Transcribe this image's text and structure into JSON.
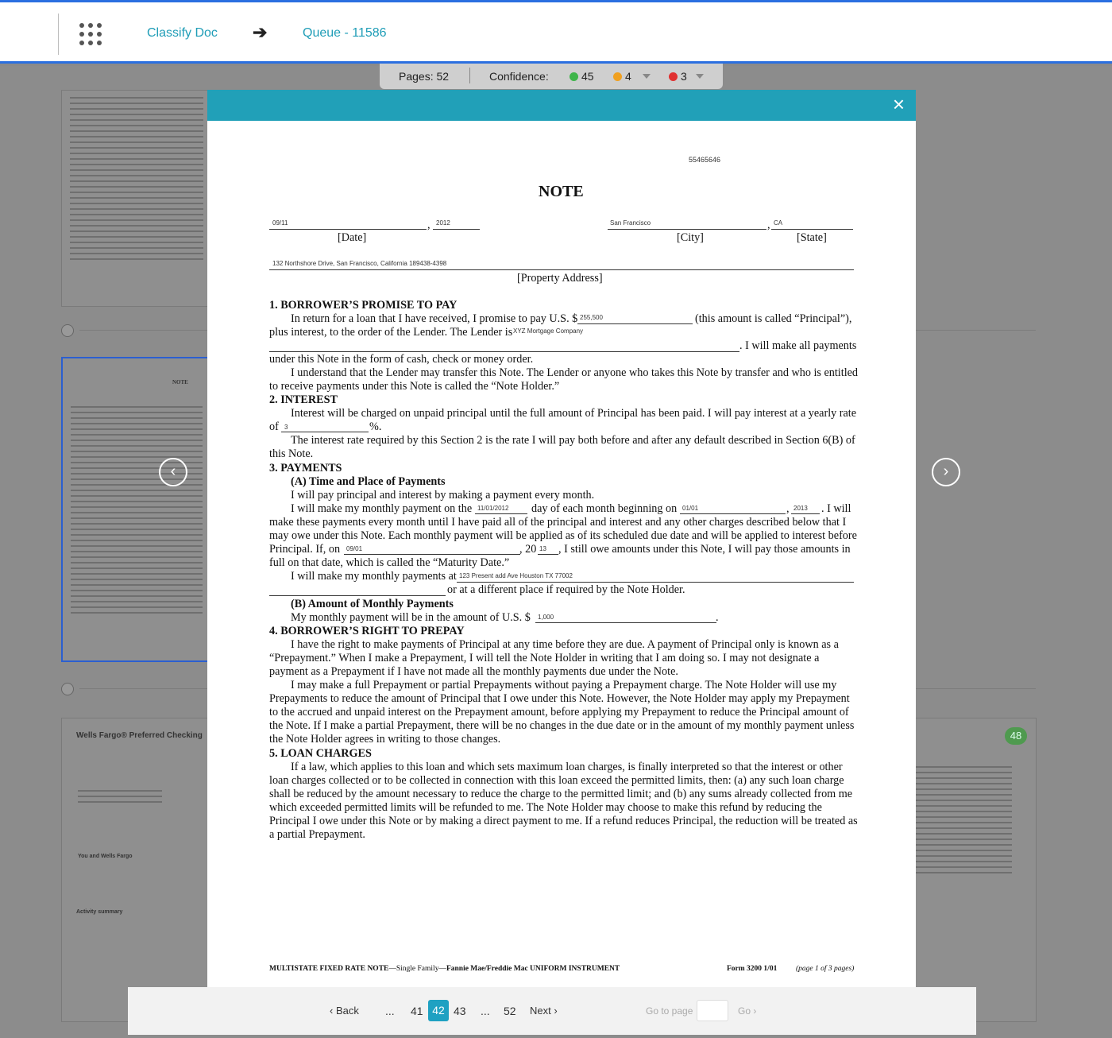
{
  "header": {
    "breadcrumb": [
      "Classify Doc",
      "Queue - 11586"
    ],
    "arrow": "➔"
  },
  "stats": {
    "pages_label": "Pages: 52",
    "confidence_label": "Confidence:",
    "green_count": "45",
    "orange_count": "4",
    "red_count": "3",
    "colors": {
      "green": "#3fb54a",
      "orange": "#f0a020",
      "red": "#e03030"
    }
  },
  "background": {
    "thumb2_title": "NOTE",
    "thumb3_title": "Wells Fargo® Preferred Checking",
    "thumb3_section1": "You and Wells Fargo",
    "thumb3_section2": "Activity summary",
    "page_badge": "48"
  },
  "modal": {
    "close_icon": "×",
    "doc": {
      "ref_number": "55465646",
      "title": "NOTE",
      "date_value": "09/11",
      "year_value": "2012",
      "city_value": "San Francisco",
      "state_value": "CA",
      "date_label": "[Date]",
      "city_label": "[City]",
      "state_label": "[State]",
      "address_value": "132 Northshore Drive, San Francisco, California 189438-4398",
      "address_label": "[Property Address]",
      "s1_heading": "1.   BORROWER’S PROMISE TO PAY",
      "s1_p1a": "In return for a loan that I have received, I promise to pay U.S. $",
      "principal_value": "255,500",
      "s1_p1b": "(this amount is called “Principal”),",
      "s1_p1c": "plus interest, to the order of the Lender.  The Lender is",
      "lender_value": "XYZ Mortgage Company",
      "s1_p1d": ". I will make all payments",
      "s1_p1e": "under this Note in the form of cash, check or money order.",
      "s1_p2a": "I understand that the Lender may transfer this Note.  The Lender or anyone who takes this Note by transfer and who is entitled",
      "s1_p2b": "to receive payments under this Note is called the “Note Holder.”",
      "s2_heading": "2.   INTEREST",
      "s2_p1a": "Interest will be charged on unpaid principal until the full amount of Principal has been paid.  I will pay interest at a yearly rate",
      "s2_of": "of",
      "rate_value": "3",
      "s2_pct": "%.",
      "s2_p2a": "The interest rate required by this Section 2 is the rate I will pay both before and after any default described in Section 6(B) of",
      "s2_p2b": "this Note.",
      "s3_heading": "3.   PAYMENTS",
      "s3a_heading": "(A)   Time and Place of Payments",
      "s3_p1": "I will pay principal and interest by making a payment every month.",
      "s3_p2a": "I will make my monthly payment on the",
      "payday_value": "11/01/2012",
      "s3_p2b": "day of each month beginning on",
      "begin_value": "01/01",
      "begin_year": "2013",
      "s3_p2c": ".  I will",
      "s3_p3": "make these payments every month until I have paid all of the principal and interest and any other charges described below that I",
      "s3_p4": "may owe under this Note.  Each monthly payment will be applied as of its scheduled due date and will be applied to interest before",
      "s3_p5a": "Principal.  If, on",
      "maturity_value": "09/01",
      "s3_p5b": ", 20",
      "maturity_year": "13",
      "s3_p5c": ", I still owe amounts under this Note, I will pay those amounts in",
      "s3_p6": "full on that date, which is called the “Maturity Date.”",
      "s3_p7": "I will make my monthly payments at",
      "pay_address_value": "123 Present add Ave Houston TX 77002",
      "s3_p8": "or at a different place if required by the Note Holder.",
      "s3b_heading": "(B)   Amount of Monthly Payments",
      "s3b_p1": "My monthly payment will be in the amount of U.S. $",
      "payment_value": "1,000",
      "s3b_dot": ".",
      "s4_heading": "4.   BORROWER’S RIGHT TO PREPAY",
      "s4_lines": [
        "I have the right to make payments of Principal at any time before they are due.  A payment of Principal only is known as a",
        "“Prepayment.”  When I make a Prepayment, I will tell the Note Holder in writing that I am doing so.  I may not designate a",
        "payment as a Prepayment if I have not made all the monthly payments due under the Note.",
        "I may make a full Prepayment or partial Prepayments without paying a Prepayment charge.  The Note Holder will use my",
        "Prepayments to reduce the amount of Principal that I owe under this Note.  However, the Note Holder may apply my Prepayment",
        "to the accrued and unpaid interest on the Prepayment amount, before applying my Prepayment to reduce the Principal amount of",
        "the Note.  If I make a partial Prepayment, there will be no changes in the due date or in the amount of my monthly payment unless",
        "the Note Holder agrees in writing to those changes."
      ],
      "s5_heading": "5.   LOAN CHARGES",
      "s5_lines": [
        "If a law, which applies to this loan and which sets maximum loan charges, is finally interpreted so that the interest or other",
        "loan charges collected or to be collected in connection with this loan exceed the permitted limits, then:  (a) any such loan charge",
        "shall be reduced by the amount necessary to reduce the charge to the permitted limit; and (b) any sums already collected from me",
        "which exceeded permitted limits will be refunded to me.  The Note Holder may choose to make this refund by reducing the",
        "Principal I owe under this Note or by making a direct payment to me.  If a refund reduces Principal, the reduction will be treated as",
        "a partial Prepayment."
      ],
      "footer_left_a": "MULTISTATE FIXED RATE NOTE",
      "footer_left_b": "—Single Family—",
      "footer_left_c": "Fannie Mae/Freddie Mac UNIFORM INSTRUMENT",
      "footer_form": "Form 3200    1/01",
      "footer_page": "(page 1 of 3 pages)"
    }
  },
  "pager": {
    "back": "‹ Back",
    "ellipsis": "...",
    "pages": [
      "41",
      "42",
      "43"
    ],
    "last": "52",
    "next": "Next ›",
    "goto_label": "Go to page",
    "goto_value": "",
    "go": "Go ›"
  },
  "nav": {
    "prev_icon": "‹",
    "next_icon": "›"
  }
}
